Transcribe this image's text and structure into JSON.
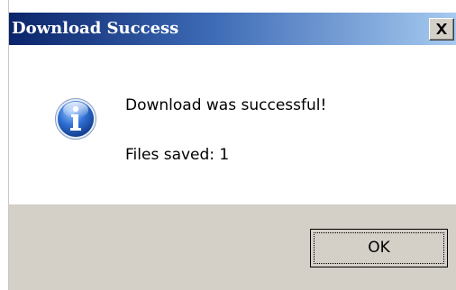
{
  "dialog": {
    "title": "Download Success",
    "close_icon": "close-icon",
    "message": "Download was successful!",
    "files_saved": "Files saved: 1",
    "ok_label": "OK",
    "icon": "info-icon"
  },
  "colors": {
    "titlebar_start": "#0a246a",
    "titlebar_end": "#a6caf0",
    "footer": "#d4d0c8",
    "icon_blue": "#2f6fd3"
  }
}
